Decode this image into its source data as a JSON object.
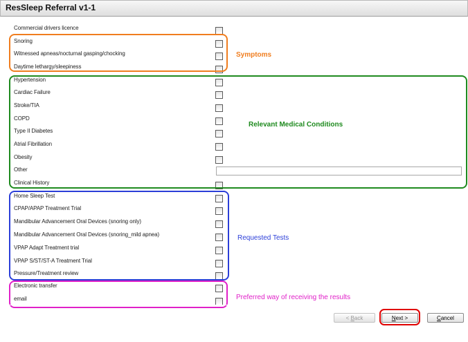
{
  "window": {
    "title": "ResSleep Referral v1-1"
  },
  "rows": [
    {
      "label": "Commercial drivers licence"
    },
    {
      "label": "Snoring"
    },
    {
      "label": "Witnessed apneas/nocturnal gasping/chocking"
    },
    {
      "label": "Daytime lethargy/sleepiness"
    },
    {
      "label": "Hypertension"
    },
    {
      "label": "Cardiac Failure"
    },
    {
      "label": "Stroke/TIA"
    },
    {
      "label": "COPD"
    },
    {
      "label": "Type II Diabetes"
    },
    {
      "label": "Atrial Fibrillation"
    },
    {
      "label": "Obesity"
    },
    {
      "label": "Other"
    },
    {
      "label": "Clinical History"
    },
    {
      "label": "Home Sleep Test"
    },
    {
      "label": "CPAP/APAP Treatment Trial"
    },
    {
      "label": "Mandibular Advancement Oral Devices (snoring only)"
    },
    {
      "label": "Mandibular Advancement Oral Devices (snoring_mild apnea)"
    },
    {
      "label": "VPAP Adapt Treatment trial"
    },
    {
      "label": "VPAP S/ST/ST-A Treatment Trial"
    },
    {
      "label": "Pressure/Treatment review"
    },
    {
      "label": "Electronic transfer"
    },
    {
      "label": "email"
    }
  ],
  "other_field": {
    "value": ""
  },
  "groups": {
    "symptoms": {
      "label": "Symptoms",
      "color": "#f07d1e"
    },
    "conditions": {
      "label": "Relevant Medical Conditions",
      "color": "#1e8a1e"
    },
    "tests": {
      "label": "Requested Tests",
      "color": "#2b3ed8"
    },
    "results": {
      "label": "Preferred way of receiving the results",
      "color": "#e020c8"
    }
  },
  "buttons": {
    "back": {
      "label": "< Back",
      "underline": "B"
    },
    "next": {
      "label": "Next >",
      "underline": "N"
    },
    "cancel": {
      "label": "Cancel",
      "underline": "C"
    }
  },
  "highlight_color": "#e00000"
}
